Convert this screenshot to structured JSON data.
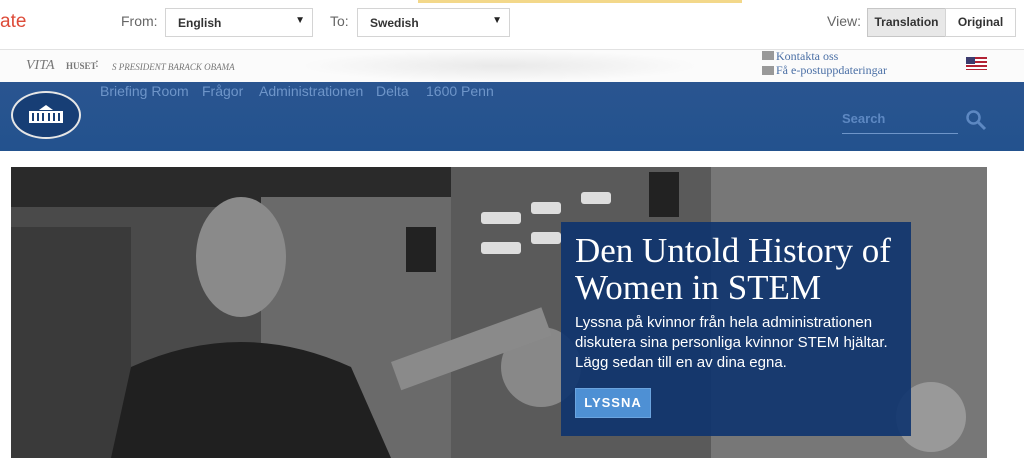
{
  "toolbar": {
    "brand": "ate",
    "from_label": "From:",
    "from_value": "English",
    "to_label": "To:",
    "to_value": "Swedish",
    "view_label": "View:",
    "translation_label": "Translation",
    "original_label": "Original"
  },
  "header": {
    "vita": "VITA",
    "huset": "HUSET",
    "colon": ":",
    "president": "S PRESIDENT BARACK OBAMA",
    "contact": "Kontakta oss",
    "email_updates": "Få e-postuppdateringar"
  },
  "nav": {
    "items": [
      {
        "label": "Briefing Room"
      },
      {
        "label": "Frågor"
      },
      {
        "label": "Administrationen"
      },
      {
        "label": "Delta"
      },
      {
        "label": "1600 Penn"
      }
    ],
    "search_placeholder": "Search"
  },
  "hero": {
    "title": "Den Untold History of Women in STEM",
    "text": "Lyssna på kvinnor från hela administrationen diskutera sina personliga kvinnor STEM hjältar. Lägg sedan till en av dina egna.",
    "button": "LYSSNA"
  },
  "colors": {
    "nav_blue": "#23528e",
    "panel_blue": "#0d336e",
    "brand_red": "#dd4b39",
    "button_blue": "#4e90d4"
  }
}
